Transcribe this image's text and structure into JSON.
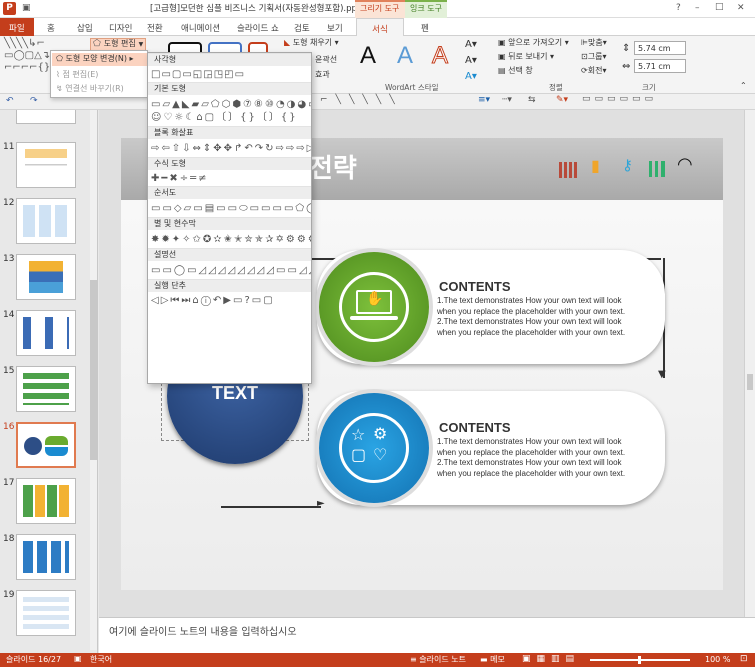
{
  "window": {
    "title": "[고급형]모던한 심플 비즈니스 기획서(자동완성형포함).pptx - PowerPoint",
    "context_groups": [
      {
        "label": "그리기 도구"
      },
      {
        "label": "잉크 도구"
      }
    ],
    "controls": [
      "?",
      "–",
      "□",
      "✕"
    ]
  },
  "tabs": [
    {
      "label": "파일"
    },
    {
      "label": "홈"
    },
    {
      "label": "삽입"
    },
    {
      "label": "디자인"
    },
    {
      "label": "전환"
    },
    {
      "label": "애니메이션"
    },
    {
      "label": "슬라이드 쇼"
    },
    {
      "label": "검토"
    },
    {
      "label": "보기"
    },
    {
      "label": "서식"
    },
    {
      "label": "펜"
    }
  ],
  "ribbon": {
    "edit_shape_label": "도형 편집",
    "shape_fill": "도형 채우기",
    "shape_outline_abbrev": "윤곽선",
    "shape_effect_abbrev": "효과",
    "wordart_group": "WordArt 스타일",
    "arrange": {
      "bring_forward": "앞으로 가져오기",
      "send_backward": "뒤로 보내기",
      "selection_pane": "선택 창",
      "align": "맞춤",
      "group": "그룹",
      "rotate": "회전",
      "group_label": "정렬"
    },
    "size": {
      "height": "5.74 cm",
      "width": "5.71 cm",
      "group_label": "크기"
    }
  },
  "edit_shape_menu": {
    "items": [
      {
        "label": "도형 모양 변경(N)",
        "enabled": true
      },
      {
        "label": "점 편집(E)",
        "enabled": false
      },
      {
        "label": "연결선 바꾸기(R)",
        "enabled": false
      }
    ]
  },
  "shape_gallery": {
    "sections": [
      {
        "name": "사각형",
        "shapes": "□▭▢▭◱◲◳◰▭"
      },
      {
        "name": "기본 도형",
        "shapes": "▭▱▲◣▰▱⬠⬡⬢⑦⑧⑩◔◑◕▭▭▭□▭▭◯▣▢⊘◠◡☺♡☼☾⌂▢〔〕{}〔〕{}"
      },
      {
        "name": "블록 화살표",
        "shapes": "⇨⇦⇧⇩⇔⇕✥✥↱↶↷↻⇨⇨⇨▷⇨⇨⇦⇧⇩⇔⇕✥⇄⤺⤻↶↷⮌⮎"
      },
      {
        "name": "수식 도형",
        "shapes": "✚━✖÷═≠"
      },
      {
        "name": "순서도",
        "shapes": "▭▭◇▱▭▤▭▭⬭▭▭▭▭⬠◯▭▭⊗⊕⊠⧖⧗▽△◩◪▭▭▭◯◡"
      },
      {
        "name": "별 및 현수막",
        "shapes": "✸✹✦✧✩✪✫✬✭✮✯✰✡⚙⚙⚙⚙⚙⚙▭▭▭⌇⌇"
      },
      {
        "name": "설명선",
        "shapes": "▭▭◯▭◿◿◿◿◿◿◿◿▭▭◿◿◿◿◿◿◿◿"
      },
      {
        "name": "실행 단추",
        "shapes": "◁▷⏮⏭⌂ⓘ↶▶▭?▭▢"
      }
    ]
  },
  "slides": [
    {
      "num": "11"
    },
    {
      "num": "12"
    },
    {
      "num": "13"
    },
    {
      "num": "14"
    },
    {
      "num": "15"
    },
    {
      "num": "16",
      "active": true
    },
    {
      "num": "17"
    },
    {
      "num": "18"
    },
    {
      "num": "19"
    }
  ],
  "slide": {
    "title_partial": "전략",
    "circle_text": "TEXT",
    "cards": [
      {
        "heading": "CONTENTS",
        "body": "1.The text demonstrates How your own text will look\nwhen you replace the placeholder with your own text.\n2.The text demonstrates How your own text will look\nwhen you replace the placeholder with your own text."
      },
      {
        "heading": "CONTENTS",
        "body": "1.The text demonstrates How your own text will look\nwhen you replace the placeholder with your own text.\n2.The text demonstrates How your own text will look\nwhen you replace the placeholder with your own text."
      }
    ]
  },
  "notes_placeholder": "여기에 슬라이드 노트의 내용을 입력하십시오",
  "status": {
    "slide_info": "슬라이드 16/27",
    "language": "한국어",
    "notes_btn": "슬라이드 노트",
    "comments_btn": "메모",
    "zoom": "100 %"
  },
  "colors": {
    "accent": "#c43e1c",
    "green": "#6aab2e",
    "blue": "#1a8bd0",
    "navy": "#2d4e86"
  }
}
